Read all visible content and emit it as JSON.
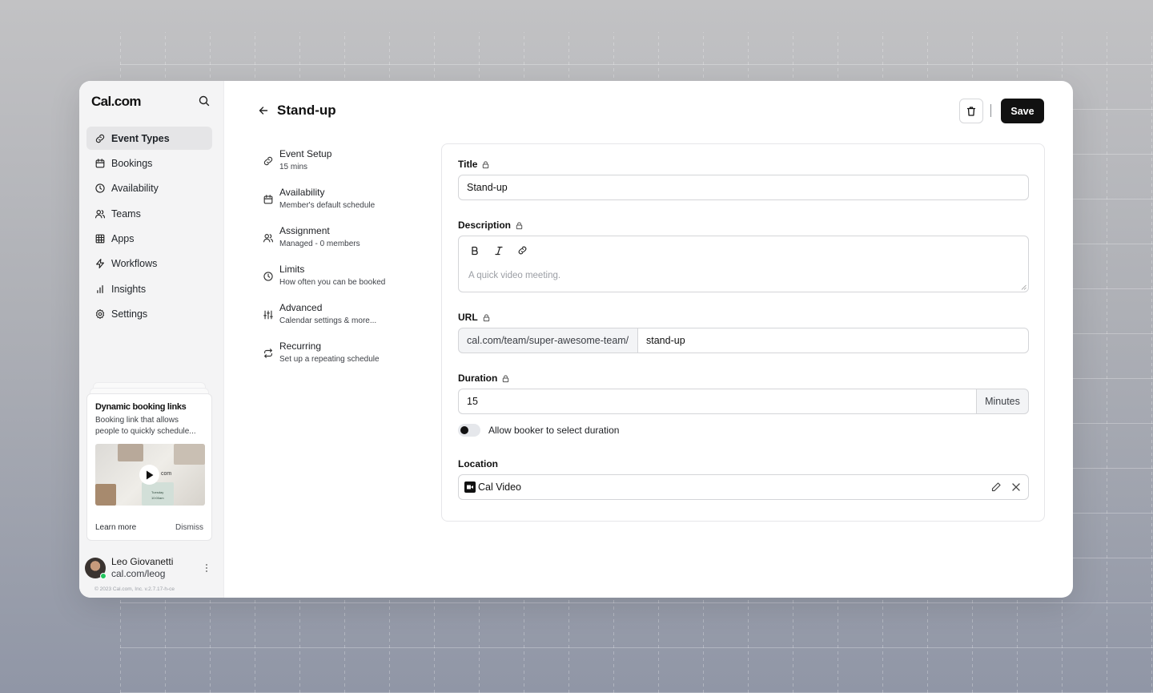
{
  "brand": {
    "logo": "Cal.com"
  },
  "sidebar": {
    "items": [
      {
        "label": "Event Types",
        "icon": "link-icon",
        "active": true
      },
      {
        "label": "Bookings",
        "icon": "calendar-icon"
      },
      {
        "label": "Availability",
        "icon": "clock-icon"
      },
      {
        "label": "Teams",
        "icon": "users-icon"
      },
      {
        "label": "Apps",
        "icon": "grid-icon"
      },
      {
        "label": "Workflows",
        "icon": "zap-icon"
      },
      {
        "label": "Insights",
        "icon": "bar-chart-icon"
      },
      {
        "label": "Settings",
        "icon": "gear-icon"
      }
    ],
    "promo": {
      "title": "Dynamic booking links",
      "description": "Booking link that allows people to quickly schedule...",
      "image_text": "com",
      "image_card_line1": "Tuesday",
      "image_card_line2": "10:00am",
      "learn_more": "Learn more",
      "dismiss": "Dismiss"
    },
    "user": {
      "name": "Leo Giovanetti",
      "handle": "cal.com/leog"
    },
    "copyright": "© 2023 Cal.com, Inc. v.2.7.17-h-ce"
  },
  "header": {
    "title": "Stand-up",
    "save_label": "Save"
  },
  "steps": [
    {
      "title": "Event Setup",
      "subtitle": "15 mins",
      "icon": "link-icon"
    },
    {
      "title": "Availability",
      "subtitle": "Member's default schedule",
      "icon": "calendar-icon"
    },
    {
      "title": "Assignment",
      "subtitle": "Managed - 0 members",
      "icon": "users-icon"
    },
    {
      "title": "Limits",
      "subtitle": "How often you can be booked",
      "icon": "clock-icon"
    },
    {
      "title": "Advanced",
      "subtitle": "Calendar settings & more...",
      "icon": "sliders-icon"
    },
    {
      "title": "Recurring",
      "subtitle": "Set up a repeating schedule",
      "icon": "repeat-icon"
    }
  ],
  "form": {
    "title_label": "Title",
    "title_value": "Stand-up",
    "description_label": "Description",
    "description_placeholder": "A quick video meeting.",
    "url_label": "URL",
    "url_prefix": "cal.com/team/super-awesome-team/",
    "url_value": "stand-up",
    "duration_label": "Duration",
    "duration_value": "15",
    "duration_unit": "Minutes",
    "toggle_label": "Allow booker to select duration",
    "toggle_on": false,
    "location_label": "Location",
    "location_value": "Cal Video"
  },
  "colors": {
    "accent": "#111111",
    "sidebar_bg": "#f4f4f5",
    "online": "#22c55e"
  }
}
